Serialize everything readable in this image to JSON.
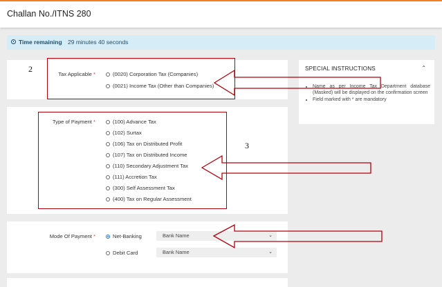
{
  "header": {
    "title": "Challan No./ITNS 280"
  },
  "timer": {
    "icon": "clock-icon",
    "label": "Time remaining",
    "value": "29 minutes 40 seconds"
  },
  "tax_applicable": {
    "label": "Tax Applicable",
    "required_mark": "*",
    "options": [
      {
        "label": "(0020) Corporation Tax (Companies)",
        "selected": false
      },
      {
        "label": "(0021) Income Tax (Other than Companies)",
        "selected": false
      }
    ]
  },
  "type_of_payment": {
    "label": "Type of Payment",
    "required_mark": "*",
    "options": [
      {
        "label": "(100) Advance Tax",
        "selected": false
      },
      {
        "label": "(102) Surtax",
        "selected": false
      },
      {
        "label": "(106) Tax on Distributed Profit",
        "selected": false
      },
      {
        "label": "(107) Tax on Distributed Income",
        "selected": false
      },
      {
        "label": "(110) Secondary Adjustment Tax",
        "selected": false
      },
      {
        "label": "(111) Accretion Tax",
        "selected": false
      },
      {
        "label": "(300) Self Assessment Tax",
        "selected": false
      },
      {
        "label": "(400) Tax on Regular Assessment",
        "selected": false
      }
    ]
  },
  "mode_of_payment": {
    "label": "Mode Of Payment",
    "required_mark": "*",
    "options": [
      {
        "label": "Net-Banking",
        "selected": true,
        "select_value": "Bank Name"
      },
      {
        "label": "Debit Card",
        "selected": false,
        "select_value": "Bank Name"
      }
    ]
  },
  "special_instructions": {
    "title": "SPECIAL INSTRUCTIONS",
    "items": [
      "Name as per Income Tax Department database (Masked) will be displayed on the confirmation screen",
      "Field marked with * are mandatory"
    ]
  },
  "annotations": {
    "step_2": "2",
    "step_3": "3"
  },
  "colors": {
    "accent": "#f58220",
    "annotation_red": "#b3000c",
    "selected_radio": "#1a73e8",
    "timer_bg": "#d6ecf6"
  }
}
